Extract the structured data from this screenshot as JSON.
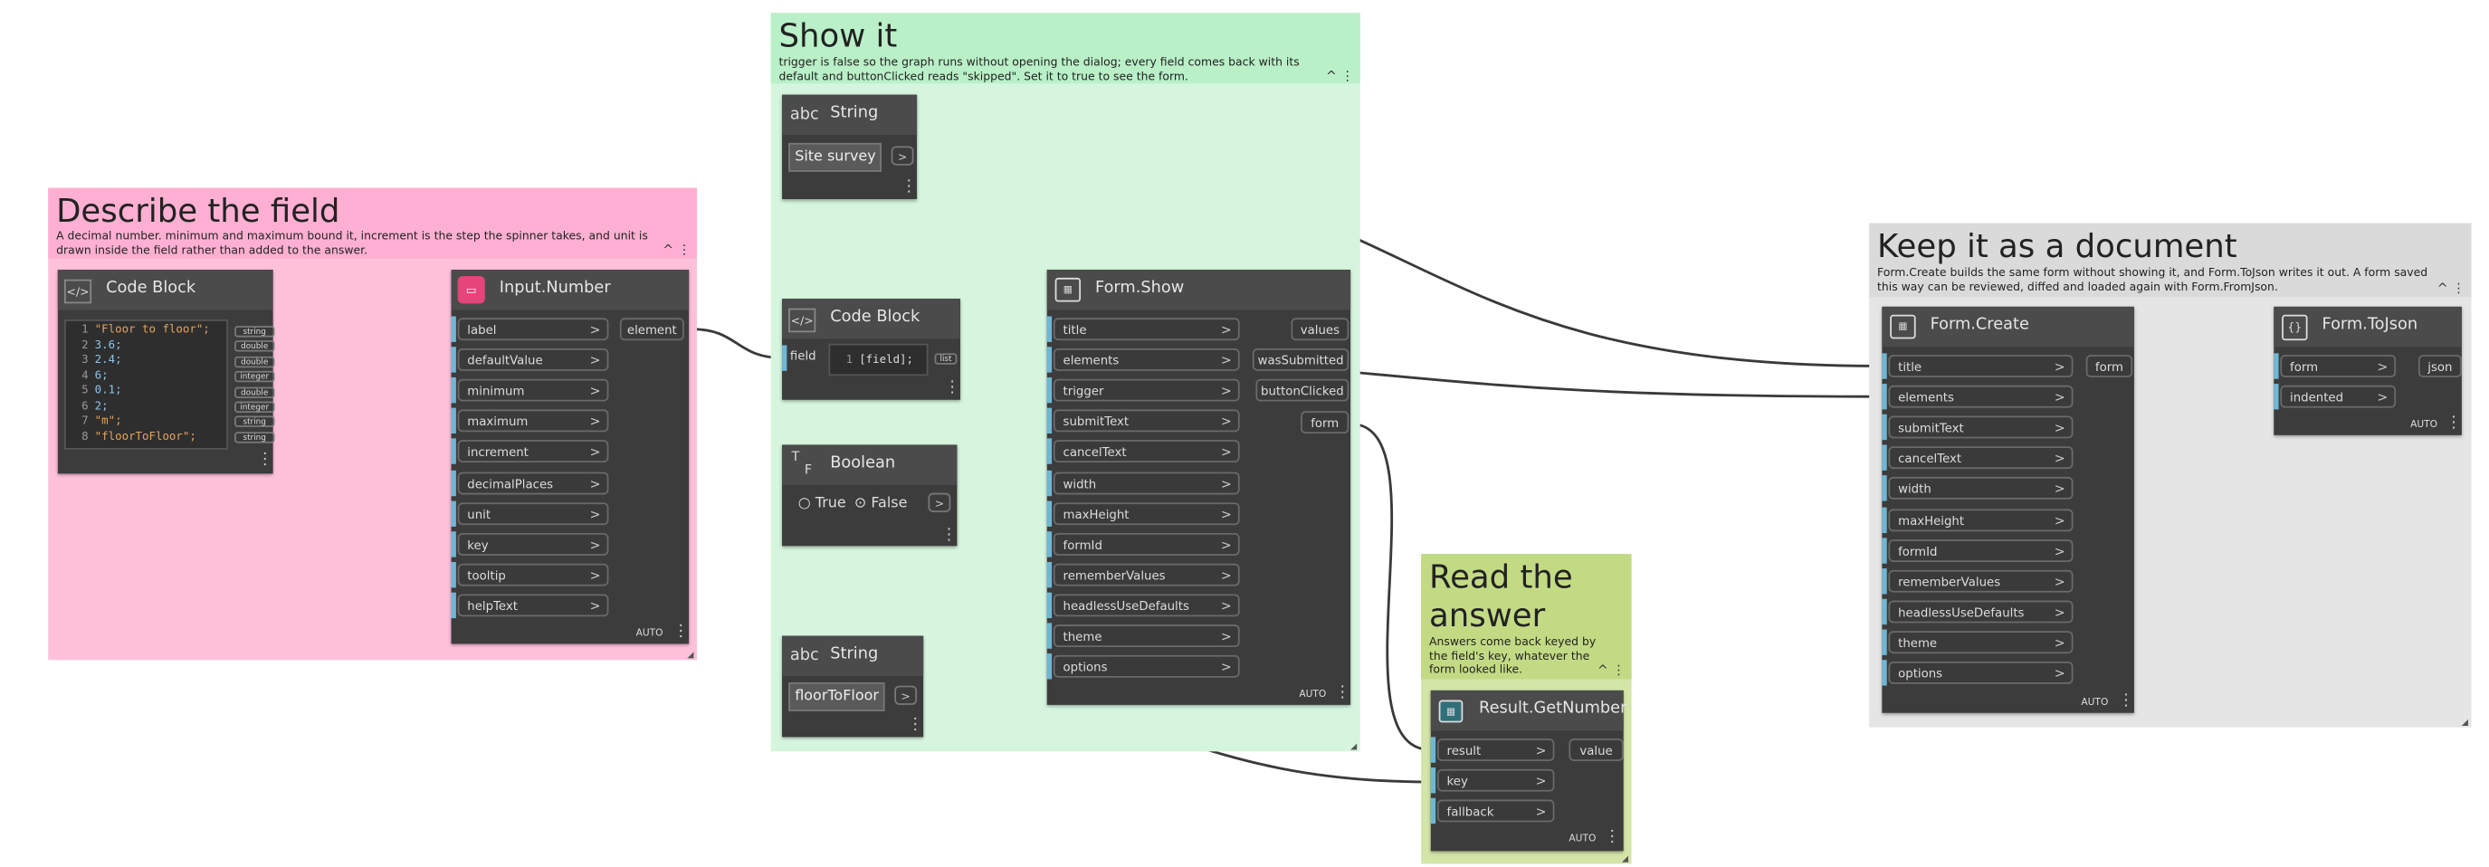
{
  "groups": {
    "describe": {
      "title": "Describe the field",
      "desc": "A decimal number. minimum and maximum bound it, increment is the step the spinner takes, and unit is drawn inside the field rather than added to the answer.",
      "color": "#ffc0da",
      "headcolor": "#ffb0d2"
    },
    "show": {
      "title": "Show it",
      "desc": "trigger is false so the graph runs without opening the dialog; every field comes back with its default and buttonClicked reads \"skipped\". Set it to true to see the form.",
      "color": "#d6f5de",
      "headcolor": "#baf0c8"
    },
    "answer": {
      "title": "Read the answer",
      "desc": "Answers come back keyed by the field's key, whatever the form looked like.",
      "color": "#d4e5a8",
      "headcolor": "#c3da84"
    },
    "document": {
      "title": "Keep it as a document",
      "desc": "Form.Create builds the same form without showing it, and Form.ToJson writes it out. A form saved this way can be reviewed, diffed and loaded again with Form.FromJson.",
      "color": "#e5e5e5",
      "headcolor": "#dadada"
    }
  },
  "nodes": {
    "code1": {
      "title": "Code Block",
      "lines": [
        {
          "n": "1",
          "text": "\"Floor to floor\";",
          "kind": "str",
          "tag": "string"
        },
        {
          "n": "2",
          "text": "3.6;",
          "kind": "num",
          "tag": "double"
        },
        {
          "n": "3",
          "text": "2.4;",
          "kind": "num",
          "tag": "double"
        },
        {
          "n": "4",
          "text": "6;",
          "kind": "num",
          "tag": "integer"
        },
        {
          "n": "5",
          "text": "0.1;",
          "kind": "num",
          "tag": "double"
        },
        {
          "n": "6",
          "text": "2;",
          "kind": "num",
          "tag": "integer"
        },
        {
          "n": "7",
          "text": "\"m\";",
          "kind": "str",
          "tag": "string"
        },
        {
          "n": "8",
          "text": "\"floorToFloor\";",
          "kind": "str",
          "tag": "string"
        }
      ]
    },
    "inputNumber": {
      "title": "Input.Number",
      "inputs": [
        "label",
        "defaultValue",
        "minimum",
        "maximum",
        "increment",
        "decimalPlaces",
        "unit",
        "key",
        "tooltip",
        "helpText"
      ],
      "output": "element",
      "lacing": "AUTO"
    },
    "stringSite": {
      "title": "String",
      "value": "Site survey"
    },
    "code2": {
      "title": "Code Block",
      "line_n": "1",
      "line": "[field];",
      "in": "field",
      "out": "list"
    },
    "boolean": {
      "title": "Boolean",
      "true_label": "True",
      "false_label": "False"
    },
    "stringKey": {
      "title": "String",
      "value": "floorToFloor"
    },
    "formShow": {
      "title": "Form.Show",
      "inputs": [
        "title",
        "elements",
        "trigger",
        "submitText",
        "cancelText",
        "width",
        "maxHeight",
        "formId",
        "rememberValues",
        "headlessUseDefaults",
        "theme",
        "options"
      ],
      "outputs": [
        "values",
        "wasSubmitted",
        "buttonClicked",
        "form"
      ],
      "lacing": "AUTO"
    },
    "resultGetNumber": {
      "title": "Result.GetNumber",
      "inputs": [
        "result",
        "key",
        "fallback"
      ],
      "output": "value",
      "lacing": "AUTO"
    },
    "formCreate": {
      "title": "Form.Create",
      "inputs": [
        "title",
        "elements",
        "submitText",
        "cancelText",
        "width",
        "maxHeight",
        "formId",
        "rememberValues",
        "headlessUseDefaults",
        "theme",
        "options"
      ],
      "output": "form",
      "lacing": "AUTO"
    },
    "formToJson": {
      "title": "Form.ToJson",
      "inputs": [
        "form",
        "indented"
      ],
      "output": "json",
      "lacing": "AUTO"
    }
  },
  "glyphs": {
    "arrow": ">",
    "dots": "⋮",
    "collapse": "^",
    "abc": "abc",
    "tf_t": "T",
    "tf_f": "F"
  },
  "colors": {
    "node": "#3c3c3c",
    "header": "#4b4b4b",
    "port_bar": "#6fb7d6",
    "wire": "#3a3a3a"
  }
}
